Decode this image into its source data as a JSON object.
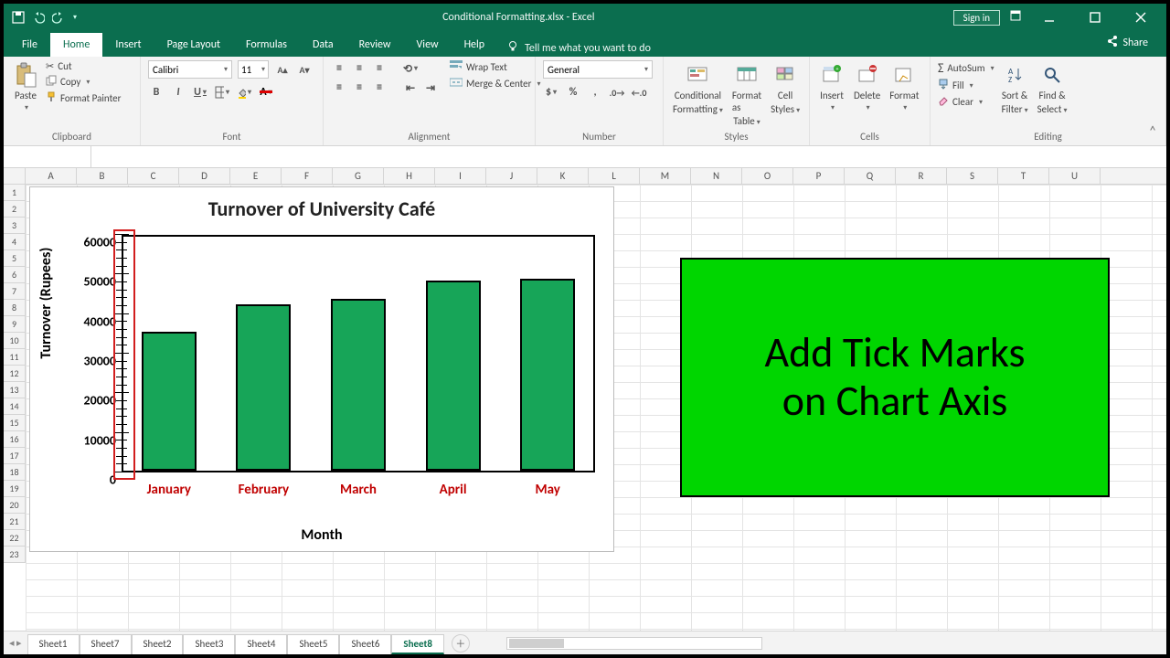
{
  "app": {
    "doc_title": "Conditional Formatting.xlsx - Excel",
    "signin": "Sign in",
    "share": "Share"
  },
  "tabs": [
    "File",
    "Home",
    "Insert",
    "Page Layout",
    "Formulas",
    "Data",
    "Review",
    "View",
    "Help"
  ],
  "tell_me": "Tell me what you want to do",
  "ribbon": {
    "clipboard": {
      "paste": "Paste",
      "cut": "Cut",
      "copy": "Copy",
      "painter": "Format Painter",
      "label": "Clipboard"
    },
    "font": {
      "name": "Calibri",
      "size": "11",
      "label": "Font"
    },
    "alignment": {
      "wrap": "Wrap Text",
      "merge": "Merge & Center",
      "label": "Alignment"
    },
    "number": {
      "format": "General",
      "label": "Number"
    },
    "styles": {
      "cond": "Conditional",
      "cond2": "Formatting",
      "fat": "Format as",
      "fat2": "Table",
      "cell": "Cell",
      "cell2": "Styles",
      "label": "Styles"
    },
    "cells": {
      "insert": "Insert",
      "delete": "Delete",
      "format": "Format",
      "label": "Cells"
    },
    "editing": {
      "autosum": "AutoSum",
      "fill": "Fill",
      "clear": "Clear",
      "sort": "Sort &",
      "sort2": "Filter",
      "find": "Find &",
      "find2": "Select",
      "label": "Editing"
    }
  },
  "columns": [
    "A",
    "B",
    "C",
    "D",
    "E",
    "F",
    "G",
    "H",
    "I",
    "J",
    "K",
    "L",
    "M",
    "N",
    "O",
    "P",
    "Q",
    "R",
    "S",
    "T",
    "U"
  ],
  "sheets": [
    "Sheet1",
    "Sheet7",
    "Sheet2",
    "Sheet3",
    "Sheet4",
    "Sheet5",
    "Sheet6",
    "Sheet8"
  ],
  "active_sheet": "Sheet8",
  "callout": {
    "line1": "Add Tick Marks",
    "line2": "on Chart Axis"
  },
  "chart_data": {
    "type": "bar",
    "title": "Turnover of University Café",
    "xlabel": "Month",
    "ylabel": "Turnover (Rupees)",
    "categories": [
      "January",
      "February",
      "March",
      "April",
      "May"
    ],
    "values": [
      35000,
      42000,
      43500,
      48000,
      48500
    ],
    "y_ticks": [
      0,
      10000,
      20000,
      30000,
      40000,
      50000,
      60000
    ],
    "ylim": [
      0,
      60000
    ],
    "bar_color": "#17a558"
  }
}
